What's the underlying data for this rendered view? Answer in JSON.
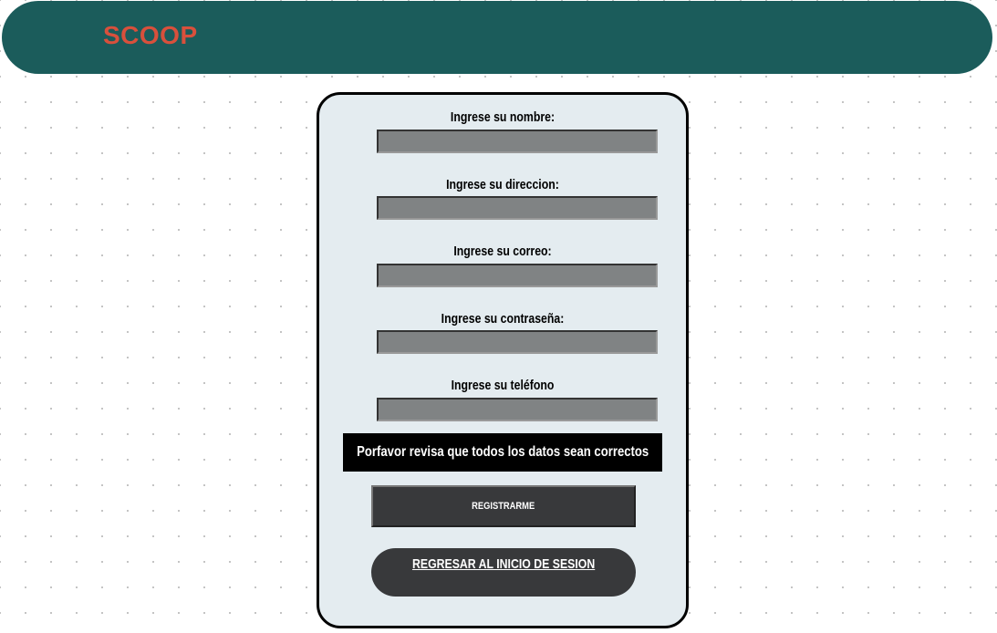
{
  "header": {
    "brand": "SCOOP"
  },
  "form": {
    "fields": [
      {
        "label": "Ingrese su nombre:",
        "value": ""
      },
      {
        "label": "Ingrese su direccion:",
        "value": ""
      },
      {
        "label": "Ingrese su correo:",
        "value": ""
      },
      {
        "label": "Ingrese su contraseña:",
        "value": ""
      },
      {
        "label": "Ingrese su teléfono",
        "value": ""
      }
    ],
    "notice": "Porfavor revisa que todos los datos sean correctos",
    "register_label": "REGISTRARME",
    "back_label": "REGRESAR AL INICIO DE SESION"
  },
  "colors": {
    "header_bg": "#1b5c5b",
    "brand": "#d8503c",
    "card_bg": "#e4ecf0",
    "field_bg": "#808384",
    "button_bg": "#38393b"
  }
}
